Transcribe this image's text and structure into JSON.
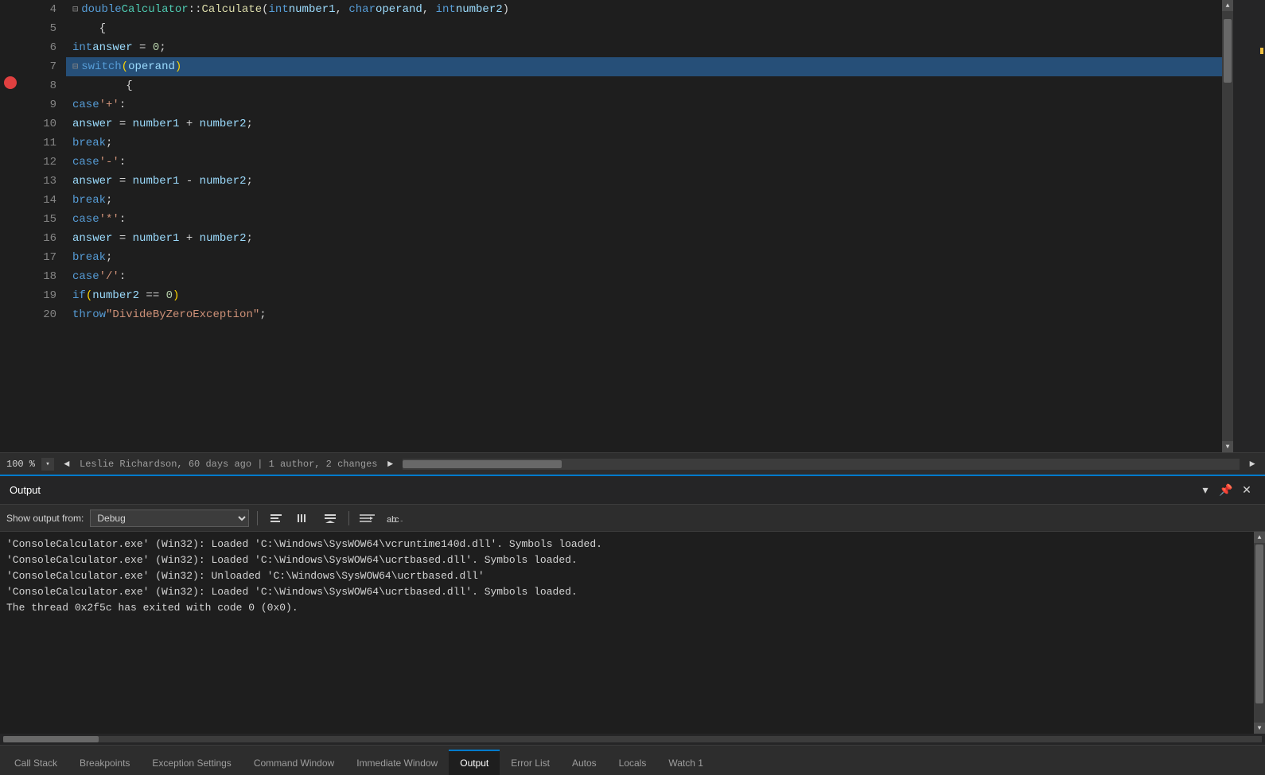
{
  "editor": {
    "lines": [
      {
        "num": "4",
        "indent": 0,
        "content_html": "<span class='fold-indicator'>⊟</span><span class='kw'>double</span> <span class='cls'>Calculator</span>::<span class='fn'>Calculate</span>(<span class='kw'>int</span> <span class='var'>number1</span>, <span class='kw'>char</span> <span class='var'>operand</span>, <span class='kw'>int</span> <span class='var'>number2</span>)",
        "highlight": false,
        "breakpoint": false
      },
      {
        "num": "5",
        "indent": 0,
        "content_html": "    {",
        "highlight": false,
        "breakpoint": false
      },
      {
        "num": "6",
        "indent": 0,
        "content_html": "        <span class='kw'>int</span> <span class='var'>answer</span> = <span class='num'>0</span>;",
        "highlight": false,
        "breakpoint": false
      },
      {
        "num": "7",
        "indent": 0,
        "content_html": "<span class='fold-indicator'>⊟</span>    <span class='kw'>switch</span> <span class='paren'>(</span><span class='var'>operand</span><span class='paren'>)</span>",
        "highlight": true,
        "breakpoint": true
      },
      {
        "num": "8",
        "indent": 0,
        "content_html": "        {",
        "highlight": false,
        "breakpoint": false
      },
      {
        "num": "9",
        "indent": 0,
        "content_html": "        <span class='kw'>case</span> <span class='str'>'+'</span>:",
        "highlight": false,
        "breakpoint": false
      },
      {
        "num": "10",
        "indent": 0,
        "content_html": "            <span class='var'>answer</span> = <span class='var'>number1</span> + <span class='var'>number2</span>;",
        "highlight": false,
        "breakpoint": false
      },
      {
        "num": "11",
        "indent": 0,
        "content_html": "            <span class='kw'>break</span>;",
        "highlight": false,
        "breakpoint": false
      },
      {
        "num": "12",
        "indent": 0,
        "content_html": "        <span class='kw'>case</span> <span class='str'>'-'</span>:",
        "highlight": false,
        "breakpoint": false
      },
      {
        "num": "13",
        "indent": 0,
        "content_html": "            <span class='var'>answer</span> = <span class='var'>number1</span> - <span class='var'>number2</span>;",
        "highlight": false,
        "breakpoint": false
      },
      {
        "num": "14",
        "indent": 0,
        "content_html": "            <span class='kw'>break</span>;",
        "highlight": false,
        "breakpoint": false
      },
      {
        "num": "15",
        "indent": 0,
        "content_html": "        <span class='kw'>case</span> <span class='str'>'*'</span>:",
        "highlight": false,
        "breakpoint": false
      },
      {
        "num": "16",
        "indent": 0,
        "content_html": "            <span class='var'>answer</span> = <span class='var'>number1</span> + <span class='var'>number2</span>;",
        "highlight": false,
        "breakpoint": false
      },
      {
        "num": "17",
        "indent": 0,
        "content_html": "            <span class='kw'>break</span>;",
        "highlight": false,
        "breakpoint": false
      },
      {
        "num": "18",
        "indent": 0,
        "content_html": "        <span class='kw'>case</span> <span class='str'>'/'</span>:",
        "highlight": false,
        "breakpoint": false
      },
      {
        "num": "19",
        "indent": 0,
        "content_html": "            <span class='kw'>if</span> <span class='paren'>(</span><span class='var'>number2</span> == <span class='num'>0</span><span class='paren'>)</span>",
        "highlight": false,
        "breakpoint": false
      },
      {
        "num": "20",
        "indent": 0,
        "content_html": "                <span class='kw'>throw</span> <span class='str'>\"DivideByZeroException\"</span>;",
        "highlight": false,
        "breakpoint": false
      }
    ],
    "zoom_percent": "100 %",
    "author_info": "Leslie Richardson, 60 days ago | 1 author, 2 changes"
  },
  "output_panel": {
    "title": "Output",
    "show_output_label": "Show output from:",
    "selected_source": "Debug",
    "messages": [
      "'ConsoleCalculator.exe' (Win32): Loaded 'C:\\Windows\\SysWOW64\\vcruntime140d.dll'. Symbols loaded.",
      "'ConsoleCalculator.exe' (Win32): Loaded 'C:\\Windows\\SysWOW64\\ucrtbased.dll'. Symbols loaded.",
      "'ConsoleCalculator.exe' (Win32): Unloaded 'C:\\Windows\\SysWOW64\\ucrtbased.dll'",
      "'ConsoleCalculator.exe' (Win32): Loaded 'C:\\Windows\\SysWOW64\\ucrtbased.dll'. Symbols loaded.",
      "The thread 0x2f5c has exited with code 0 (0x0)."
    ]
  },
  "bottom_tabs": {
    "tabs": [
      {
        "label": "Call Stack",
        "active": false
      },
      {
        "label": "Breakpoints",
        "active": false
      },
      {
        "label": "Exception Settings",
        "active": false
      },
      {
        "label": "Command Window",
        "active": false
      },
      {
        "label": "Immediate Window",
        "active": false
      },
      {
        "label": "Output",
        "active": true
      },
      {
        "label": "Error List",
        "active": false
      },
      {
        "label": "Autos",
        "active": false
      },
      {
        "label": "Locals",
        "active": false
      },
      {
        "label": "Watch 1",
        "active": false
      }
    ]
  },
  "icons": {
    "dropdown_arrow": "▾",
    "nav_left": "◄",
    "nav_right": "►",
    "scroll_up": "▲",
    "scroll_down": "▼",
    "close": "✕",
    "pin": "📌",
    "collapse_arrow": "▾"
  }
}
